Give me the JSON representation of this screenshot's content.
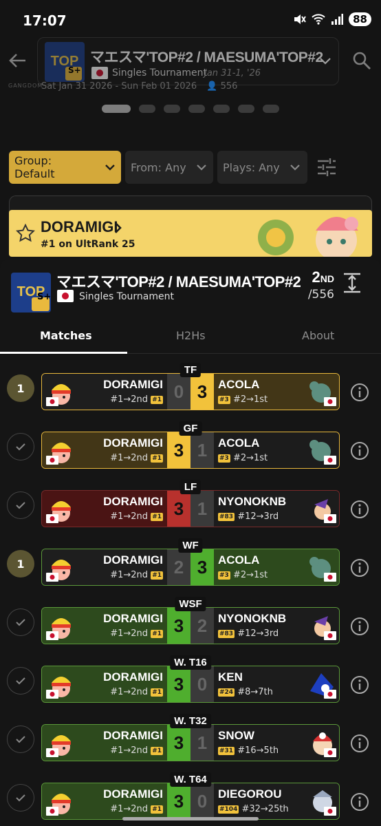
{
  "status_bar": {
    "time": "17:07",
    "battery": "88"
  },
  "header": {
    "title": "マエスマ'TOP#2 / MAESUMA'TOP#2",
    "badge": "S+",
    "type": "Singles Tournament",
    "dates": "Jan 31-1, '26"
  },
  "behind_card": {
    "dates": "Sat Jan 31 2026 - Sun Feb 01 2026",
    "entrants": "556",
    "brand": "GANGDOM"
  },
  "filters": {
    "group": "Group: Default",
    "from": "From: Any",
    "plays": "Plays: Any"
  },
  "player_banner": {
    "name": "DORAMIGI",
    "rank": "#1 on UltRank 25"
  },
  "sheet": {
    "title": "マエスマ'TOP#2 / MAESUMA'TOP#2",
    "badge": "S+",
    "type": "Singles Tournament",
    "placement": "2",
    "placement_suffix": "ND",
    "total": "/556"
  },
  "tabs": [
    {
      "label": "Matches"
    },
    {
      "label": "H2Hs"
    },
    {
      "label": "About"
    }
  ],
  "colors": {
    "gold": "#f2c23b",
    "win_green": "#4fae2e",
    "loss_red": "#b8312d"
  },
  "matches": [
    {
      "round": "TF",
      "status": "1",
      "p1": {
        "name": "DORAMIGI",
        "seed": "#1→2nd",
        "badge": "#1"
      },
      "s1": "0",
      "s2": "3",
      "p2": {
        "name": "ACOLA",
        "seed": "#2→1st",
        "badge": "#3"
      }
    },
    {
      "round": "GF",
      "status": "check",
      "p1": {
        "name": "DORAMIGI",
        "seed": "#1→2nd",
        "badge": "#1"
      },
      "s1": "3",
      "s2": "1",
      "p2": {
        "name": "ACOLA",
        "seed": "#2→1st",
        "badge": "#3"
      }
    },
    {
      "round": "LF",
      "status": "check",
      "p1": {
        "name": "DORAMIGI",
        "seed": "#1→2nd",
        "badge": "#1"
      },
      "s1": "3",
      "s2": "1",
      "p2": {
        "name": "NYONOKNB",
        "seed": "#12→3rd",
        "badge": "#83"
      }
    },
    {
      "round": "WF",
      "status": "1",
      "p1": {
        "name": "DORAMIGI",
        "seed": "#1→2nd",
        "badge": "#1"
      },
      "s1": "2",
      "s2": "3",
      "p2": {
        "name": "ACOLA",
        "seed": "#2→1st",
        "badge": "#3"
      }
    },
    {
      "round": "WSF",
      "status": "check",
      "p1": {
        "name": "DORAMIGI",
        "seed": "#1→2nd",
        "badge": "#1"
      },
      "s1": "3",
      "s2": "2",
      "p2": {
        "name": "NYONOKNB",
        "seed": "#12→3rd",
        "badge": "#83"
      }
    },
    {
      "round": "W. T16",
      "status": "check",
      "p1": {
        "name": "DORAMIGI",
        "seed": "#1→2nd",
        "badge": "#1"
      },
      "s1": "3",
      "s2": "0",
      "p2": {
        "name": "KEN",
        "seed": "#8→7th",
        "badge": "#24"
      }
    },
    {
      "round": "W. T32",
      "status": "check",
      "p1": {
        "name": "DORAMIGI",
        "seed": "#1→2nd",
        "badge": "#1"
      },
      "s1": "3",
      "s2": "1",
      "p2": {
        "name": "SNOW",
        "seed": "#16→5th",
        "badge": "#31"
      }
    },
    {
      "round": "W. T64",
      "status": "check",
      "p1": {
        "name": "DORAMIGI",
        "seed": "#1→2nd",
        "badge": "#1"
      },
      "s1": "3",
      "s2": "0",
      "p2": {
        "name": "DIEGOROU",
        "seed": "#32→25th",
        "badge": "#104"
      }
    }
  ]
}
